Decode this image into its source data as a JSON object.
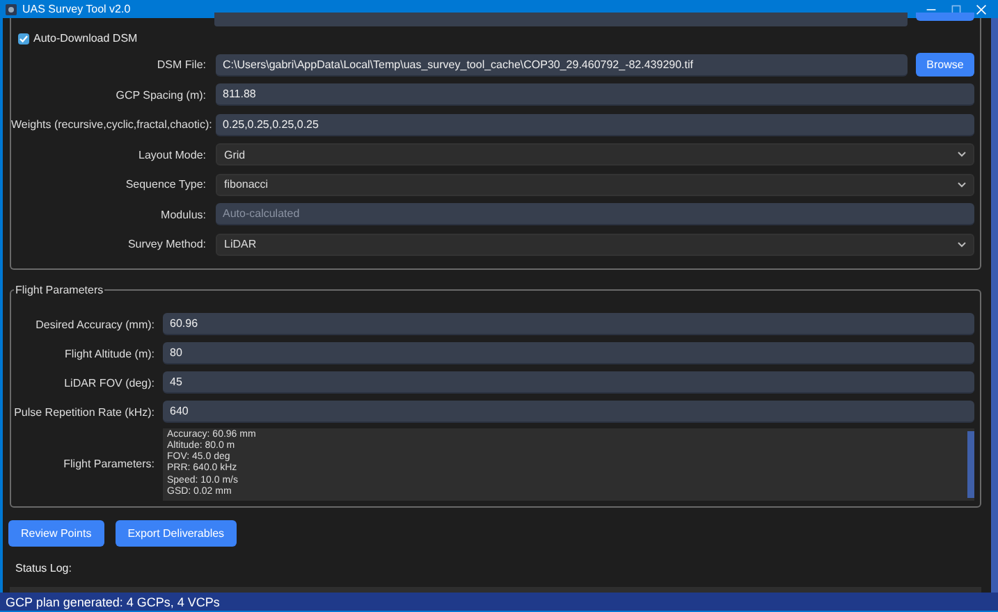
{
  "window": {
    "title": "UAS Survey Tool v2.0"
  },
  "auto_download_dsm": {
    "label": "Auto-Download DSM",
    "checked": true
  },
  "survey_fields": [
    {
      "kind": "file",
      "label": "DSM File:",
      "value": "C:\\Users\\gabri\\AppData\\Local\\Temp\\uas_survey_tool_cache\\COP30_29.460792_-82.439290.tif",
      "button": "Browse"
    },
    {
      "kind": "input",
      "label": "GCP Spacing (m):",
      "value": "811.88"
    },
    {
      "kind": "input",
      "label": "Weights (recursive,cyclic,fractal,chaotic):",
      "value": "0.25,0.25,0.25,0.25"
    },
    {
      "kind": "select",
      "label": "Layout Mode:",
      "value": "Grid"
    },
    {
      "kind": "select",
      "label": "Sequence Type:",
      "value": "fibonacci"
    },
    {
      "kind": "input",
      "label": "Modulus:",
      "placeholder": "Auto-calculated"
    },
    {
      "kind": "select",
      "label": "Survey Method:",
      "value": "LiDAR"
    }
  ],
  "flight_parameters": {
    "title": "Flight Parameters",
    "fields": [
      {
        "label": "Desired Accuracy (mm):",
        "value": "60.96"
      },
      {
        "label": "Flight Altitude (m):",
        "value": "80"
      },
      {
        "label": "LiDAR FOV (deg):",
        "value": "45"
      },
      {
        "label": "Pulse Repetition Rate (kHz):",
        "value": "640"
      }
    ],
    "summary_label": "Flight Parameters:",
    "summary_lines": [
      "Accuracy: 60.96 mm",
      "Altitude: 80.0 m",
      "FOV: 45.0 deg",
      "PRR: 640.0 kHz",
      "Speed: 10.0 m/s",
      "GSD: 0.02 mm"
    ]
  },
  "buttons": [
    "Review Points",
    "Export Deliverables"
  ],
  "status_log_label": "Status Log:",
  "status_bar": "GCP plan generated: 4 GCPs, 4 VCPs"
}
